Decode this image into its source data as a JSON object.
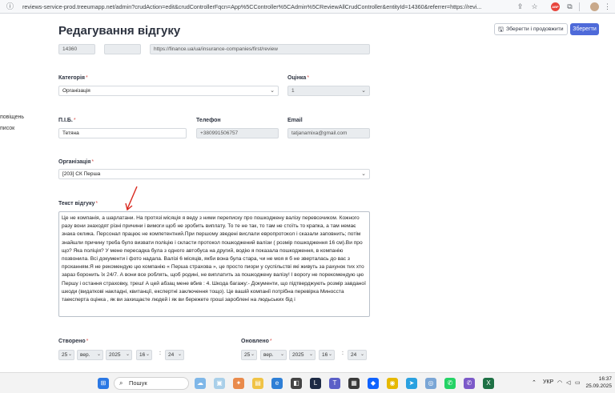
{
  "browser": {
    "url": "reviews-service-prod.treeumapp.net/admin?crudAction=edit&crudControllerFqcn=App%5CController%5CAdmin%5CReviewAllCrudController&entityId=14360&referrer=https://revi..."
  },
  "sidebar": {
    "item1": "повіщень",
    "item2": "писок"
  },
  "page": {
    "title": "Редагування відгуку",
    "save_continue_label": "Зберегти і продовжити",
    "save_label": "Зберегти"
  },
  "top_fields": {
    "id": "14360",
    "blank": "",
    "url": "https://finance.ua/ua/insurance-companies/first/review"
  },
  "category": {
    "label": "Категорія",
    "value": "Організація"
  },
  "rating": {
    "label": "Оцінка",
    "value": "1"
  },
  "name": {
    "label": "П.І.Б.",
    "value": "Тетяна"
  },
  "phone": {
    "label": "Телефон",
    "value": "+380991506757"
  },
  "email": {
    "label": "Email",
    "value": "tatjanamixa@gmail.com"
  },
  "organization": {
    "label": "Організація",
    "value": "[203] СК Перша"
  },
  "review": {
    "label": "Текст відгуку",
    "text": "Це не компанія, а шарлатани. На протязі місяція я веду з ними переписку про пошкоджену валізу перевозчиком. Кожного разу вони знаходят різні причини і вимоги щоб не зробить виплату. То те не так, то там не стоїть то крапка, а там немає знака оклика. Персонал працює не компетентний.При першому зведені вислали европротокол і сказали заповнить; потім знайшли причину треба було визвати поліцію і скласти протокол пошкоджений валізи ( розмір пошкодження 16 см).Ви про що? Яка поліція? У мене пересадка була з одного автобуса на другий, водію я показала пошкодження, в компанію позвонила. Всі документи і фото надала. Валізі 6 місяців, якби вона була стара, чи не моя я б не зверталась до вас з проханням.Я не рекомендую цю компанію « Перша страхова », це просто пиори у суспільстві які живуть за рахунок тих хто зараз боронить їх 24/7. А вони все роблять, щоб родині, не виплатить за пошкоджену валізу! І ворогу не порекомендую цю Першу і остання страховку, треш! А цей абзац мене вбив : 4. Шкода багажу:- Документи, що підтверджують розмір завданої шкоди (видаткові накладні, квитанції, експертні заключення тощо). Це вашій компанії потрібна перевірка Миносста таексперта оцінка , як ви захищаєте людей і як ви бережете гроші зароблені на людьських бід і"
  },
  "created": {
    "label": "Створено",
    "day": "25",
    "month": "вер.",
    "year": "2025",
    "hour": "16",
    "minute": "24"
  },
  "updated": {
    "label": "Оновлено",
    "day": "25",
    "month": "вер.",
    "year": "2025",
    "hour": "16",
    "minute": "24"
  },
  "taskbar": {
    "search_label": "Пошук",
    "lang": "УКР",
    "time": "16:37",
    "date": "25.09.2025"
  },
  "colors": {
    "accent": "#4e6ad9",
    "required": "#d9534f",
    "arrow": "#d9281e"
  }
}
